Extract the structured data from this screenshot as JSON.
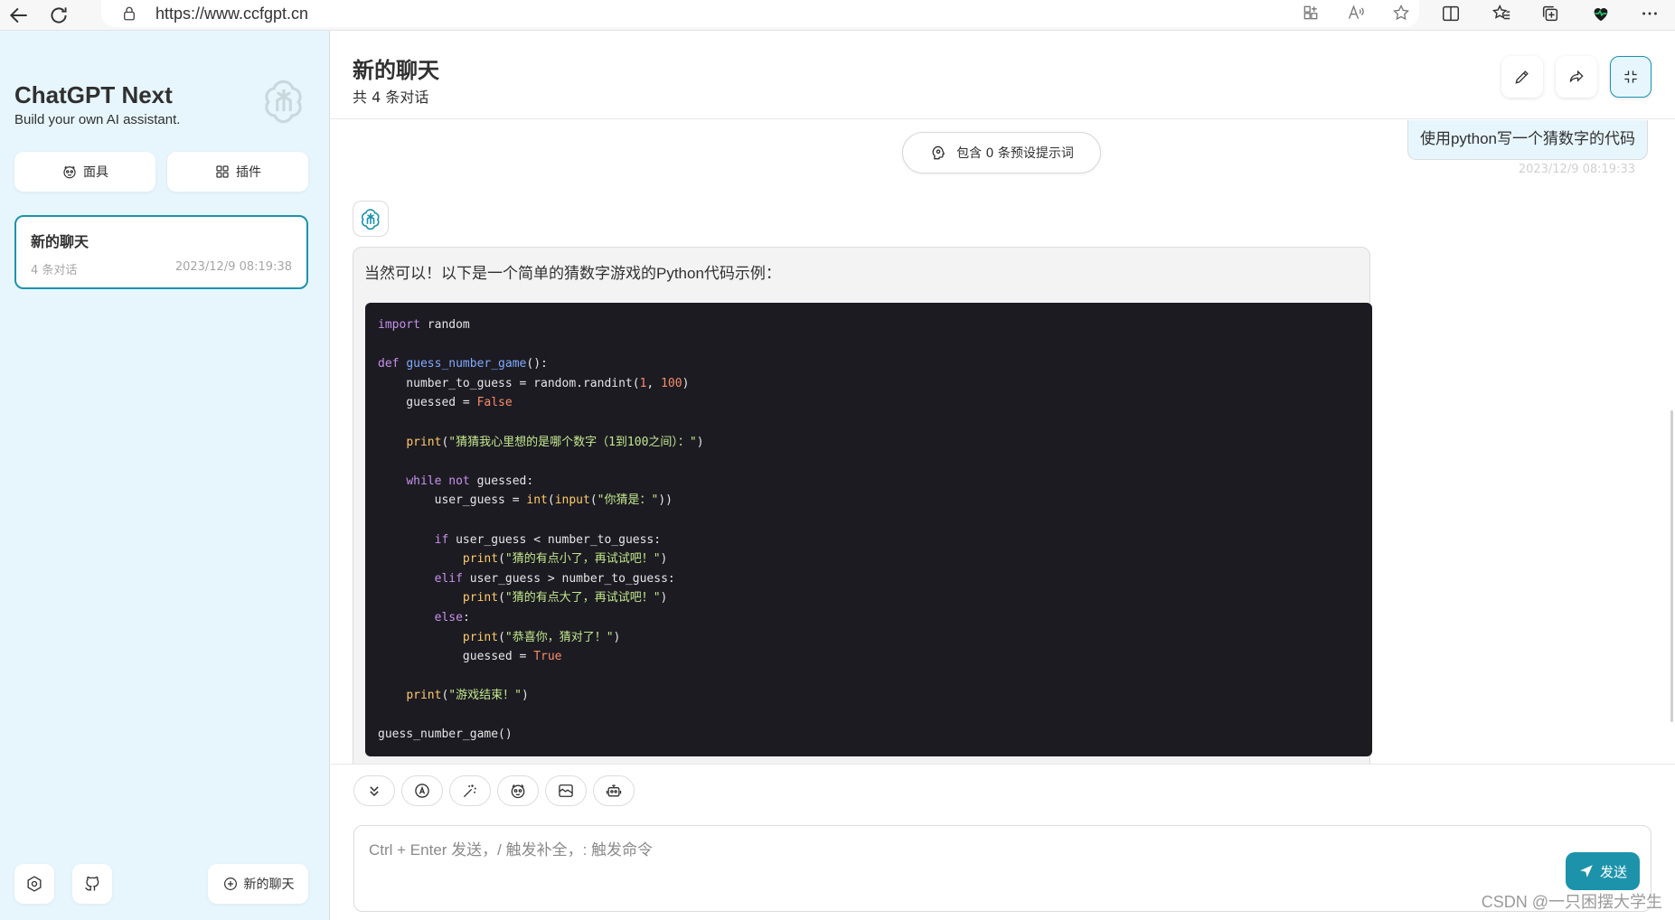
{
  "browser": {
    "url": "https://www.ccfgpt.cn"
  },
  "sidebar": {
    "title": "ChatGPT Next",
    "subtitle": "Build your own AI assistant.",
    "mask_label": "面具",
    "plugin_label": "插件",
    "chat": {
      "title": "新的聊天",
      "count": "4 条对话",
      "time": "2023/12/9 08:19:38"
    },
    "new_chat_label": "新的聊天"
  },
  "header": {
    "title": "新的聊天",
    "subtitle": "共 4 条对话"
  },
  "chat": {
    "prompt_pill": "包含 0 条预设提示词",
    "user_message": "使用python写一个猜数字的代码",
    "user_time": "2023/12/9 08:19:33",
    "bot_intro": "当然可以！以下是一个简单的猜数字游戏的Python代码示例："
  },
  "code": {
    "lines": [
      "import random",
      "",
      "def guess_number_game():",
      "    number_to_guess = random.randint(1, 100)",
      "    guessed = False",
      "",
      "    print(\"猜猜我心里想的是哪个数字（1到100之间）：\")",
      "",
      "    while not guessed:",
      "        user_guess = int(input(\"你猜是：\"))",
      "",
      "        if user_guess < number_to_guess:",
      "            print(\"猜的有点小了，再试试吧！\")",
      "        elif user_guess > number_to_guess:",
      "            print(\"猜的有点大了，再试试吧！\")",
      "        else:",
      "            print(\"恭喜你，猜对了！\")",
      "            guessed = True",
      "",
      "    print(\"游戏结束！\")",
      "",
      "guess_number_game()"
    ]
  },
  "input": {
    "placeholder": "Ctrl + Enter 发送，/ 触发补全，: 触发命令",
    "send_label": "发送"
  },
  "watermark": "CSDN @一只困摆大学生",
  "colors": {
    "accent": "#1d93ab",
    "sidebar_bg": "#e7f6fd",
    "code_bg": "#1c1b22"
  }
}
